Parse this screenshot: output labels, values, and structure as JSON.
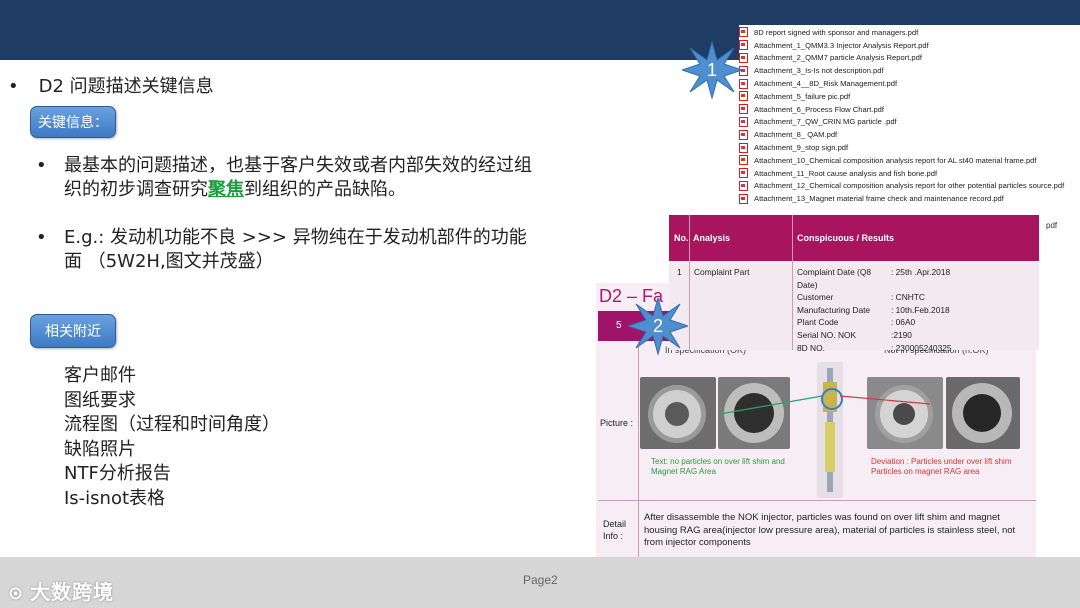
{
  "slide": {
    "title_bullet": "•",
    "title_code": "D2",
    "title_text": "问题描述关键信息",
    "key_info_label": "关键信息：",
    "bullet1": "最基本的问题描述，也基于客户失效或者内部失效的经过组织的初步调查研究",
    "bullet1_highlight": "聚焦",
    "bullet1_tail": "到组织的产品缺陷。",
    "bullet2": "E.g.: 发动机功能不良 >>> 异物纯在于发动机部件的功能面 （5W2H,图文并茂盛）",
    "related_label": "相关附近",
    "related_items": [
      "客户邮件",
      "图纸要求",
      "流程图（过程和时间角度）",
      "缺陷照片",
      "NTF分析报告",
      "Is-isnot表格"
    ],
    "page": "Page2",
    "logo_text": "大数跨境",
    "logo_mark": "⊙"
  },
  "attachments": [
    "8D report signed with sponsor and managers.pdf",
    "Attachment_1_QMM3.3 Injector Analysis Report.pdf",
    "Attachment_2_QMM7 particle Analysis Report.pdf",
    "Attachment_3_Is-Is not description.pdf",
    "Attachment_4__8D_Risk Management.pdf",
    "Attachment_5_failure pic.pdf",
    "Attachment_6_Process Flow Chart.pdf",
    "Attachment_7_QW_CRIN MG particle .pdf",
    "Attachment_8_ QAM.pdf",
    "Attachment_9_stop sign.pdf",
    "Attachment_10_Chemical composition analysis report for AL st40 material frame.pdf",
    "Attachment_11_Root cause analysis and fish bone.pdf",
    "Attachment_12_Chemical composition analysis report for other potential  particles source.pdf",
    "Attachment_13_Magnet material frame check and maintenance record.pdf"
  ],
  "callouts": {
    "one": "1",
    "two": "2"
  },
  "table": {
    "col_no": "No.",
    "col_analysis": "Analysis",
    "col_results": "Conspicuous / Results",
    "row_no": "1",
    "row_analysis": "Complaint Part",
    "fields": [
      {
        "k": "Complaint Date (Q8 Date)",
        "v": ": 25th .Apr.2018"
      },
      {
        "k": "Customer",
        "v": ": CNHTC"
      },
      {
        "k": "Manufacturing Date",
        "v": ": 10th.Feb.2018"
      },
      {
        "k": "Plant Code",
        "v": ": 06A0"
      },
      {
        "k": "Serial NO. NOK",
        "v": ":2190"
      },
      {
        "k": "8D NO.",
        "v": ": 230005240325"
      }
    ],
    "pdf_tail": "pdf"
  },
  "sheet": {
    "title": "D2 – Fa",
    "bar_num": "5",
    "hdr_left": "In specification (OK)",
    "hdr_mid": "Injector",
    "hdr_right": "Not in specification (n.OK)",
    "picture_label": "Picture :",
    "cap_ok": "Text: no particles on over lift shim and Magnet RAG Area",
    "cap_nok": "Deviation : Particles under over lift shim Particles on magnet RAG area",
    "detail_label": "Detail Info :",
    "detail_text": "After disassemble the NOK injector, particles was found on over lift shim and magnet housing RAG area(injector low pressure area), material of particles is stainless steel, not from injector components"
  },
  "colors": {
    "top_bar": "#1f3c63",
    "accent_magenta": "#a8145e",
    "highlight_green": "#1b9e3e",
    "pill_blue": "#4a86cf"
  }
}
